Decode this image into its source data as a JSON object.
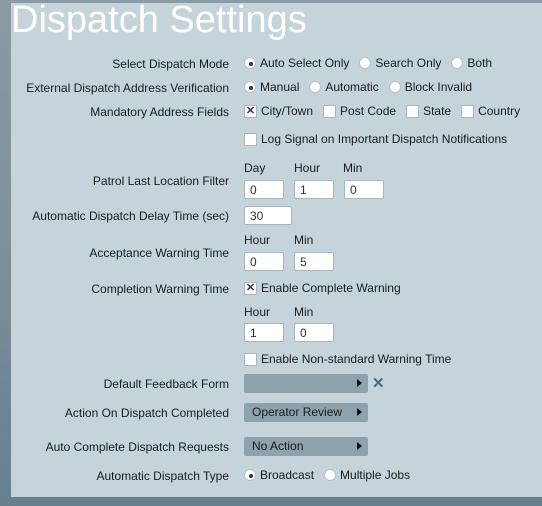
{
  "title": "Dispatch Settings",
  "dispatch_mode": {
    "label": "Select Dispatch Mode",
    "options": [
      "Auto Select Only",
      "Search Only",
      "Both"
    ],
    "selected": "Auto Select Only"
  },
  "address_verification": {
    "label": "External Dispatch Address Verification",
    "options": [
      "Manual",
      "Automatic",
      "Block Invalid"
    ],
    "selected": "Manual"
  },
  "mandatory_fields": {
    "label": "Mandatory Address Fields",
    "options": [
      {
        "label": "City/Town",
        "checked": true
      },
      {
        "label": "Post Code",
        "checked": false
      },
      {
        "label": "State",
        "checked": false
      },
      {
        "label": "Country",
        "checked": false
      }
    ]
  },
  "log_signal": {
    "label": "Log Signal on Important Dispatch Notifications",
    "checked": false
  },
  "patrol_filter": {
    "label": "Patrol Last Location Filter",
    "day_label": "Day",
    "hour_label": "Hour",
    "min_label": "Min",
    "day": "0",
    "hour": "1",
    "min": "0"
  },
  "delay_time": {
    "label": "Automatic Dispatch Delay Time (sec)",
    "value": "30"
  },
  "acceptance_warning": {
    "label": "Acceptance Warning Time",
    "hour_label": "Hour",
    "min_label": "Min",
    "hour": "0",
    "min": "5"
  },
  "completion_warning": {
    "label": "Completion Warning Time",
    "enable_label": "Enable Complete Warning",
    "enabled": true,
    "hour_label": "Hour",
    "min_label": "Min",
    "hour": "1",
    "min": "0",
    "nonstandard_label": "Enable Non-standard Warning Time",
    "nonstandard": false
  },
  "feedback_form": {
    "label": "Default Feedback Form",
    "value": "",
    "clear_icon": "close-icon"
  },
  "action_completed": {
    "label": "Action On Dispatch Completed",
    "value": "Operator Review"
  },
  "auto_complete": {
    "label": "Auto Complete Dispatch Requests",
    "value": "No Action"
  },
  "dispatch_type": {
    "label": "Automatic Dispatch Type",
    "options": [
      "Broadcast",
      "Multiple Jobs"
    ],
    "selected": "Broadcast"
  },
  "colors": {
    "panel": "#c4d4da",
    "dropdown": "#8fa1aa",
    "title": "#ffffff",
    "clear_icon": "#4f6b7b"
  }
}
